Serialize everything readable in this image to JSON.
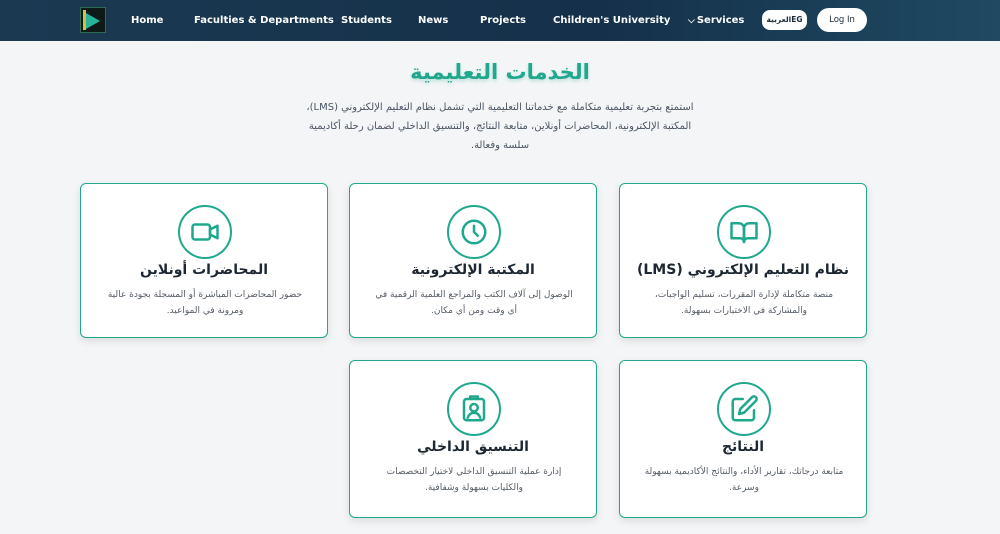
{
  "nav": {
    "home": "Home",
    "faculties": "Faculties & Departments",
    "students": "Students",
    "news": "News",
    "projects": "Projects",
    "childrens_university": "Children's University",
    "services": "Services",
    "lang_button": "العربيةEG",
    "login": "Log In"
  },
  "section": {
    "title": "الخدمات التعليمية",
    "description": "استمتع بتجربة تعليمية متكاملة مع خدماتنا التعليمية التي تشمل نظام التعليم الإلكتروني (LMS)، المكتبة الإلكترونية، المحاضرات أونلاين، متابعة النتائج، والتنسيق الداخلي لضمان رحلة أكاديمية سلسة وفعالة."
  },
  "cards": [
    {
      "icon": "book-open-icon",
      "title": "نظام التعليم الإلكتروني (LMS)",
      "desc": "منصة متكاملة لإدارة المقررات، تسليم الواجبات، والمشاركة في الاختبارات بسهولة."
    },
    {
      "icon": "clock-icon",
      "title": "المكتبة الإلكترونية",
      "desc": "الوصول إلى آلاف الكتب والمراجع العلمية الرقمية في أي وقت ومن أي مكان."
    },
    {
      "icon": "video-camera-icon",
      "title": "المحاضرات أونلاين",
      "desc": "حضور المحاضرات المباشرة أو المسجلة بجودة عالية ومرونة في المواعيد."
    },
    {
      "icon": "edit-icon",
      "title": "النتائج",
      "desc": "متابعة درجاتك، تقارير الأداء، والنتائج الأكاديمية بسهولة وسرعة."
    },
    {
      "icon": "id-badge-icon",
      "title": "التنسيق الداخلي",
      "desc": "إدارة عملية التنسيق الداخلي لاختيار التخصصات والكليات بسهولة وشفافية."
    }
  ],
  "colors": {
    "accent": "#1fa88d",
    "navbar": "#1b3a52",
    "background": "#f3f5f6"
  }
}
